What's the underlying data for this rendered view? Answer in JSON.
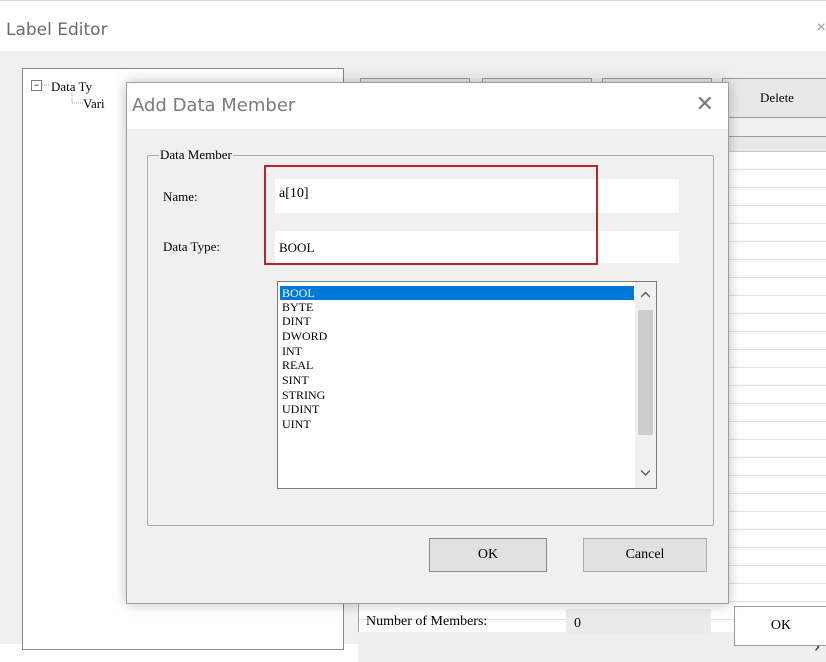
{
  "editor": {
    "title": "Label Editor",
    "close": "×"
  },
  "tree": {
    "expander": "−",
    "root": "Data Ty",
    "child": "Vari"
  },
  "right_panel": {
    "buttons": [
      "",
      "",
      "",
      "Delete"
    ],
    "members_label": "Number of Members:",
    "members_value": "0",
    "ok_label": "OK",
    "scroll_right": "›"
  },
  "dialog": {
    "title": "Add Data Member",
    "close": "✕",
    "group_label": "Data Member",
    "name_label": "Name:",
    "name_value": "a[10]",
    "type_label": "Data Type:",
    "type_value": "BOOL",
    "type_options": [
      "BOOL",
      "BYTE",
      "DINT",
      "DWORD",
      "INT",
      "REAL",
      "SINT",
      "STRING",
      "UDINT",
      "UINT"
    ],
    "selected_option": "BOOL",
    "ok_label": "OK",
    "cancel_label": "Cancel",
    "highlight_color": "#b3282d",
    "selection_color": "#0078d7"
  }
}
